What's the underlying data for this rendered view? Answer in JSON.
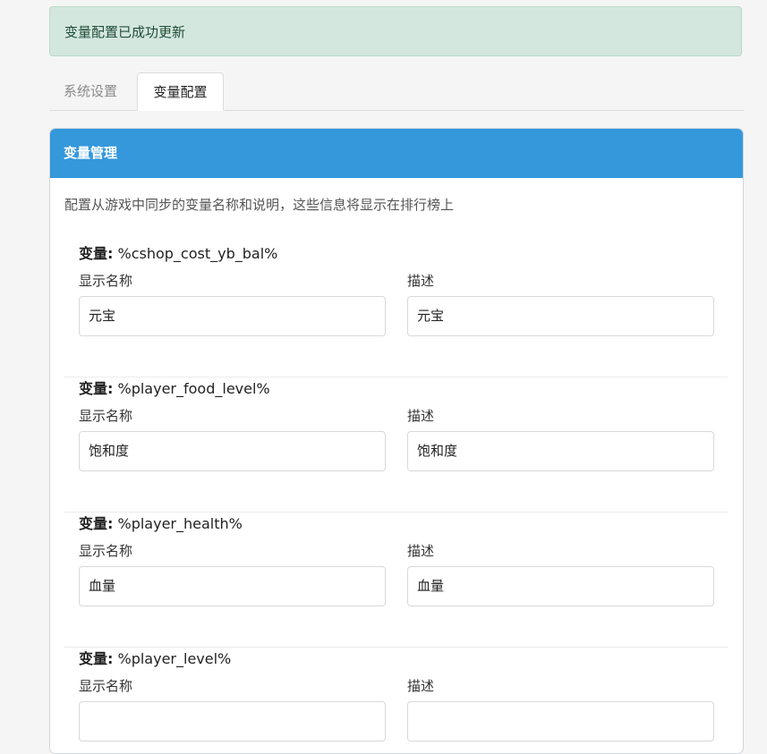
{
  "alert": {
    "message": "变量配置已成功更新"
  },
  "tabs": [
    {
      "label": "系统设置",
      "active": false
    },
    {
      "label": "变量配置",
      "active": true
    }
  ],
  "card": {
    "title": "变量管理",
    "description": "配置从游戏中同步的变量名称和说明，这些信息将显示在排行榜上",
    "var_label": "变量:",
    "display_name_label": "显示名称",
    "description_label": "描述",
    "variables": [
      {
        "name": "%cshop_cost_yb_bal%",
        "display_name": "元宝",
        "description": "元宝"
      },
      {
        "name": "%player_food_level%",
        "display_name": "饱和度",
        "description": "饱和度"
      },
      {
        "name": "%player_health%",
        "display_name": "血量",
        "description": "血量"
      },
      {
        "name": "%player_level%",
        "display_name": "",
        "description": ""
      }
    ]
  },
  "colors": {
    "header_bg": "#3498db",
    "alert_bg": "#d4e7df",
    "alert_text": "#1f4d36"
  }
}
